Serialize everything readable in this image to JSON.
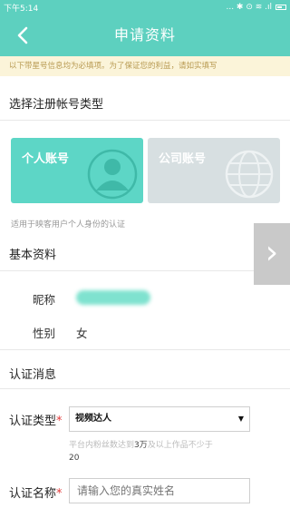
{
  "status": {
    "time": "下午5:14",
    "icons_text": "... ✱ ⊙ ≋ .ıl"
  },
  "header": {
    "title": "申请资料",
    "back_icon": "back-arrow-icon"
  },
  "notice": "以下带星号信息均为必填项。为了保证您的利益，请如实填写",
  "account_type": {
    "title": "选择注册帐号类型",
    "cards": [
      {
        "label": "个人账号",
        "icon": "user-avatar-icon",
        "selected": true
      },
      {
        "label": "公司账号",
        "icon": "globe-icon",
        "selected": false
      }
    ],
    "hint": "适用于映客用户个人身份的认证"
  },
  "basic": {
    "title": "基本资料",
    "rows": [
      {
        "label": "昵称",
        "value": ""
      },
      {
        "label": "性别",
        "value": "女"
      }
    ]
  },
  "auth": {
    "title": "认证消息",
    "type_label": "认证类型",
    "type_value": "视频达人",
    "type_hint_part1": "平台内粉丝数达到",
    "type_hint_strong": "3万",
    "type_hint_part2": "及以上作品不少于",
    "type_hint_num": "20",
    "name_label": "认证名称",
    "name_placeholder": "请输入您的真实姓名",
    "required_mark": "*"
  },
  "colors": {
    "accent": "#5dd0bf",
    "personal_card": "#5dd6c6",
    "company_card": "#d7dfe1",
    "notice_bg": "#fbf4d9"
  }
}
